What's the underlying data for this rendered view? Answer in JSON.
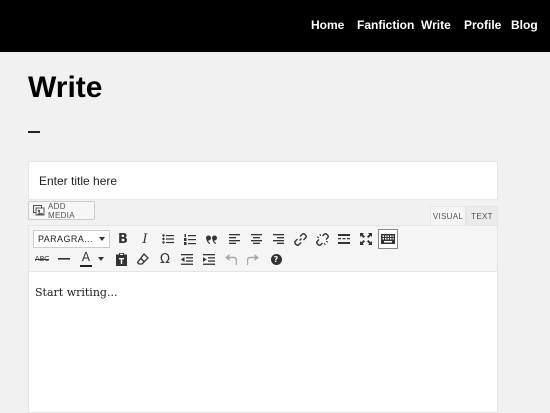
{
  "nav": {
    "items": [
      "Home",
      "Fanfiction",
      "Write",
      "Profile",
      "Blog"
    ]
  },
  "page": {
    "title": "Write",
    "title_placeholder": "Enter title here"
  },
  "editor": {
    "add_media_label": "ADD MEDIA",
    "tabs": {
      "visual": "VISUAL",
      "text": "TEXT"
    },
    "format_select_value": "PARAGRA...",
    "content_placeholder": "Start writing...",
    "toolbar_row1": [
      "bold",
      "italic",
      "bulleted-list",
      "numbered-list",
      "blockquote",
      "align-left",
      "align-center",
      "align-right",
      "insert-link",
      "remove-link",
      "read-more",
      "fullscreen",
      "toolbar-toggle"
    ],
    "toolbar_row2": [
      "strikethrough",
      "horizontal-line",
      "text-color",
      "paste-as-text",
      "clear-formatting",
      "special-character",
      "decrease-indent",
      "increase-indent",
      "undo",
      "redo",
      "keyboard-shortcuts"
    ],
    "text_color_letter": "A",
    "bold_letter": "B",
    "italic_letter": "I",
    "strike_letter": "ABC",
    "omega": "Ω",
    "help_mark": "?"
  },
  "colors": {
    "topbar": "#000000",
    "page_bg": "#f1f1f1",
    "toolbar_bg": "#f5f5f5"
  }
}
